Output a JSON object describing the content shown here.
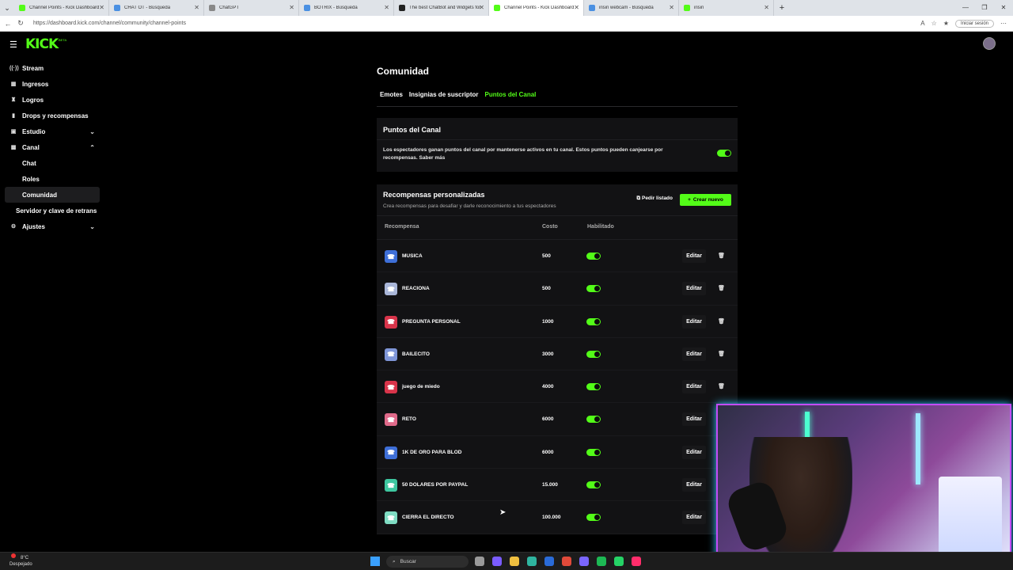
{
  "browser": {
    "tabs": [
      {
        "title": "Channel Points - Kick Dashboard",
        "color": "#53fc18",
        "active": false
      },
      {
        "title": "CHAT OT - Búsqueda",
        "color": "#4a90e2",
        "active": false
      },
      {
        "title": "ChatGPT",
        "color": "#888888",
        "active": false
      },
      {
        "title": "BOTRIX - Búsqueda",
        "color": "#4a90e2",
        "active": false
      },
      {
        "title": "The best ChatBot and Widgets for",
        "color": "#222222",
        "active": false
      },
      {
        "title": "Channel Points - Kick Dashboard",
        "color": "#53fc18",
        "active": true
      },
      {
        "title": "irisin webcam - Búsqueda",
        "color": "#4a90e2",
        "active": false
      },
      {
        "title": "irisin",
        "color": "#53fc18",
        "active": false
      }
    ],
    "url": "https://dashboard.kick.com/channel/community/channel-points",
    "signin_label": "Iniciar sesión"
  },
  "header": {
    "logo": "KICK",
    "logo_badge": "BETA"
  },
  "sidebar": {
    "items": [
      {
        "label": "Stream",
        "icon": "broadcast-icon",
        "glyph": "((·))",
        "chevron": ""
      },
      {
        "label": "Ingresos",
        "icon": "chart-icon",
        "glyph": "▦",
        "chevron": ""
      },
      {
        "label": "Logros",
        "icon": "trophy-icon",
        "glyph": "♜",
        "chevron": ""
      },
      {
        "label": "Drops y recompensas",
        "icon": "bars-icon",
        "glyph": "▮",
        "chevron": ""
      },
      {
        "label": "Estudio",
        "icon": "grid-icon",
        "glyph": "▣",
        "chevron": "⌄"
      },
      {
        "label": "Canal",
        "icon": "channel-icon",
        "glyph": "▩",
        "chevron": "⌃"
      }
    ],
    "sub_items": [
      "Chat",
      "Roles",
      "Comunidad"
    ],
    "active_sub": "Comunidad",
    "extra_item": "Servidor y clave de retrans",
    "settings_item": "Ajustes"
  },
  "main": {
    "title": "Comunidad",
    "tabs": [
      "Emotes",
      "Insignias de suscriptor",
      "Puntos del Canal"
    ],
    "active_tab": "Puntos del Canal",
    "points_card": {
      "title": "Puntos del Canal",
      "description": "Los espectadores ganan puntos del canal por mantenerse activos en tu canal. Estos puntos pueden canjearse por recompensas. Saber más",
      "enabled": true
    },
    "rewards": {
      "title": "Recompensas personalizadas",
      "subtitle": "Crea recompensas para desafiar y darle reconocimiento a tus espectadores",
      "list_button": "Pedir listado",
      "new_button": "Crear nuevo",
      "columns": [
        "Recompensa",
        "Costo",
        "Habilitado"
      ],
      "edit_label": "Editar",
      "rows": [
        {
          "name": "MUSICA",
          "cost": "500",
          "color": "#3e6fd8",
          "enabled": true,
          "deletable": true
        },
        {
          "name": "REACIONA",
          "cost": "500",
          "color": "#a9b6d8",
          "enabled": true,
          "deletable": true
        },
        {
          "name": "PREGUNTA PERSONAL",
          "cost": "1000",
          "color": "#d8344a",
          "enabled": true,
          "deletable": true
        },
        {
          "name": "BAILECITO",
          "cost": "3000",
          "color": "#7f96d8",
          "enabled": true,
          "deletable": true
        },
        {
          "name": "juego de miedo",
          "cost": "4000",
          "color": "#d8344a",
          "enabled": true,
          "deletable": true
        },
        {
          "name": "RETO",
          "cost": "6000",
          "color": "#e06a8a",
          "enabled": true,
          "deletable": false
        },
        {
          "name": "1K DE ORO PARA BLOD",
          "cost": "6000",
          "color": "#3e6fd8",
          "enabled": true,
          "deletable": false
        },
        {
          "name": "50 DOLARES POR PAYPAL",
          "cost": "15.000",
          "color": "#3ec7a0",
          "enabled": true,
          "deletable": false
        },
        {
          "name": "CIERRA EL DIRECTO",
          "cost": "100.000",
          "color": "#7fdcc3",
          "enabled": true,
          "deletable": false
        }
      ]
    }
  },
  "taskbar": {
    "weather_temp": "8°C",
    "weather_text": "Despejado",
    "search_placeholder": "Buscar",
    "app_colors": [
      "#9a9a9a",
      "#7a5cff",
      "#f0c040",
      "#2fb5a0",
      "#2a6bd8",
      "#e04a3a",
      "#7a66ff",
      "#1db954",
      "#25d366",
      "#ff2d6b"
    ]
  }
}
